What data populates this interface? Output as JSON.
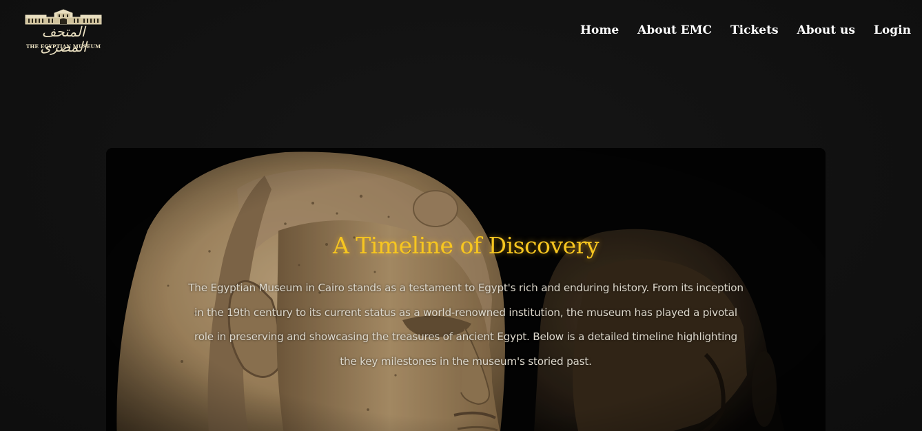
{
  "logo": {
    "arabic_text": "المتحف المصرى",
    "english_text": "THE EGYPTIAN MUSEUM",
    "icon": "museum-building-icon"
  },
  "nav": {
    "items": [
      {
        "label": "Home"
      },
      {
        "label": "About EMC"
      },
      {
        "label": "Tickets"
      },
      {
        "label": "About us"
      },
      {
        "label": "Login"
      }
    ]
  },
  "hero": {
    "title": "A Timeline of Discovery",
    "description": "The Egyptian Museum in Cairo stands as a testament to Egypt's rich and enduring history. From its inception in the 19th century to its current status as a world-renowned institution, the museum has played a pivotal role in preserving and showcasing the treasures of ancient Egypt. Below is a detailed timeline highlighting the key milestones in the museum's storied past.",
    "image": "sphinx-statue-heads"
  },
  "colors": {
    "page_background": "#111111",
    "title_gold": "#f7c620",
    "nav_text": "#ffffff",
    "body_text": "#ddd8cc",
    "logo_cream": "#e9dfc0"
  }
}
